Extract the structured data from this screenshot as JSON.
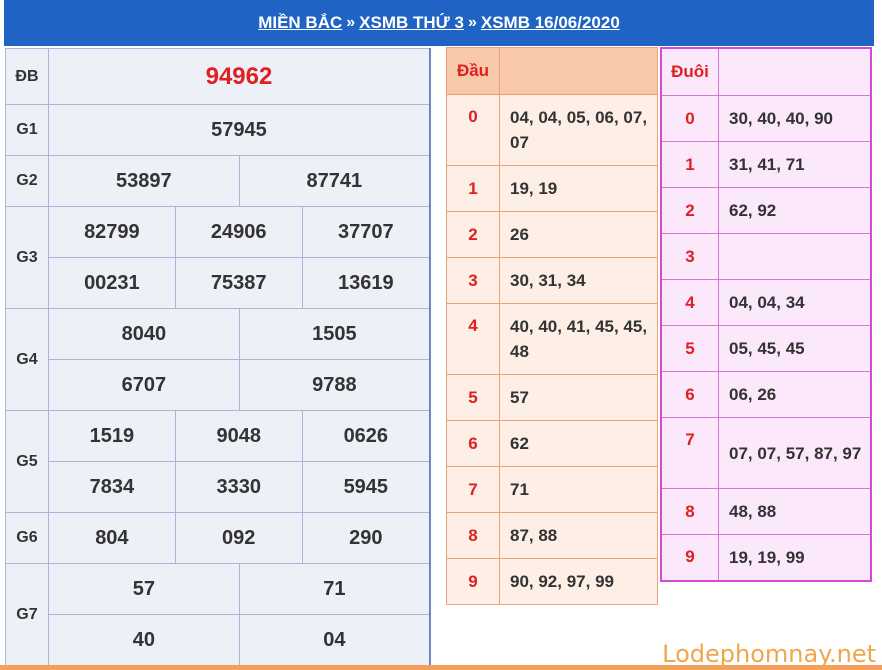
{
  "breadcrumb": {
    "item1": "MIỀN BẮC",
    "item2": "XSMB THỨ 3",
    "item3": "XSMB 16/06/2020",
    "separator": "»"
  },
  "prizes": {
    "db": {
      "label": "ĐB",
      "numbers": [
        "94962"
      ]
    },
    "g1": {
      "label": "G1",
      "numbers": [
        "57945"
      ]
    },
    "g2": {
      "label": "G2",
      "numbers": [
        "53897",
        "87741"
      ]
    },
    "g3": {
      "label": "G3",
      "numbers": [
        "82799",
        "24906",
        "37707",
        "00231",
        "75387",
        "13619"
      ]
    },
    "g4": {
      "label": "G4",
      "numbers": [
        "8040",
        "1505",
        "6707",
        "9788"
      ]
    },
    "g5": {
      "label": "G5",
      "numbers": [
        "1519",
        "9048",
        "0626",
        "7834",
        "3330",
        "5945"
      ]
    },
    "g6": {
      "label": "G6",
      "numbers": [
        "804",
        "092",
        "290"
      ]
    },
    "g7": {
      "label": "G7",
      "numbers": [
        "57",
        "71",
        "40",
        "04"
      ]
    }
  },
  "dau": {
    "header": "Đầu",
    "rows": [
      {
        "key": "0",
        "values": "04, 04, 05, 06, 07, 07"
      },
      {
        "key": "1",
        "values": "19, 19"
      },
      {
        "key": "2",
        "values": "26"
      },
      {
        "key": "3",
        "values": "30, 31, 34"
      },
      {
        "key": "4",
        "values": "40, 40, 41, 45, 45, 48"
      },
      {
        "key": "5",
        "values": "57"
      },
      {
        "key": "6",
        "values": "62"
      },
      {
        "key": "7",
        "values": "71"
      },
      {
        "key": "8",
        "values": "87, 88"
      },
      {
        "key": "9",
        "values": "90, 92, 97, 99"
      }
    ]
  },
  "duoi": {
    "header": "Đuôi",
    "rows": [
      {
        "key": "0",
        "values": "30, 40, 40, 90"
      },
      {
        "key": "1",
        "values": "31, 41, 71"
      },
      {
        "key": "2",
        "values": "62, 92"
      },
      {
        "key": "3",
        "values": ""
      },
      {
        "key": "4",
        "values": "04, 04, 34"
      },
      {
        "key": "5",
        "values": "05, 45, 45"
      },
      {
        "key": "6",
        "values": "06, 26"
      },
      {
        "key": "7",
        "values": "07, 07, 57, 87, 97"
      },
      {
        "key": "8",
        "values": "48, 88"
      },
      {
        "key": "9",
        "values": "19, 19, 99"
      }
    ]
  },
  "watermark": "Lodephomnay.net",
  "colors": {
    "header_bg": "#1f64c4",
    "special_prize": "#e02020",
    "dau_border": "#e9a27c",
    "duoi_border": "#d34bd3"
  }
}
